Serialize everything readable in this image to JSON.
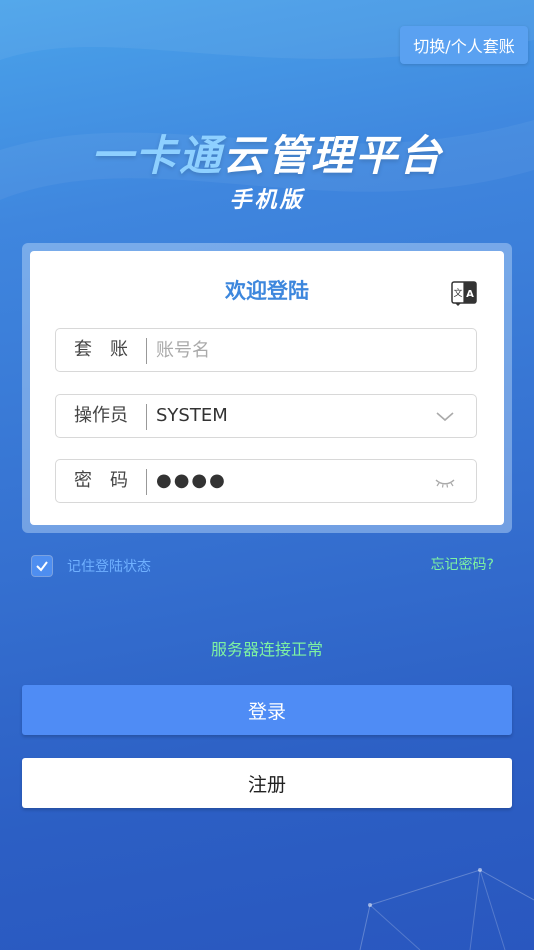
{
  "header": {
    "switch_label": "切换/个人套账",
    "title_accent": "一卡通",
    "title_rest": "云管理平台",
    "subtitle": "手机版"
  },
  "login_card": {
    "title": "欢迎登陆",
    "language_icon": "translate-icon",
    "account": {
      "label": "套　账",
      "placeholder": "账号名",
      "value": ""
    },
    "operator": {
      "label": "操作员",
      "value": "SYSTEM",
      "icon": "chevron-down-icon"
    },
    "password": {
      "label": "密　码",
      "masked_value": "●●●●",
      "icon": "eye-closed-icon"
    }
  },
  "options": {
    "remember_label": "记住登陆状态",
    "remember_checked": true,
    "forgot_label": "忘记密码?"
  },
  "status": {
    "server_text": "服务器连接正常"
  },
  "actions": {
    "login_label": "登录",
    "register_label": "注册"
  },
  "colors": {
    "accent_blue": "#4f8cf5",
    "title_blue": "#3d87dd",
    "status_green": "#7ef2a2"
  }
}
